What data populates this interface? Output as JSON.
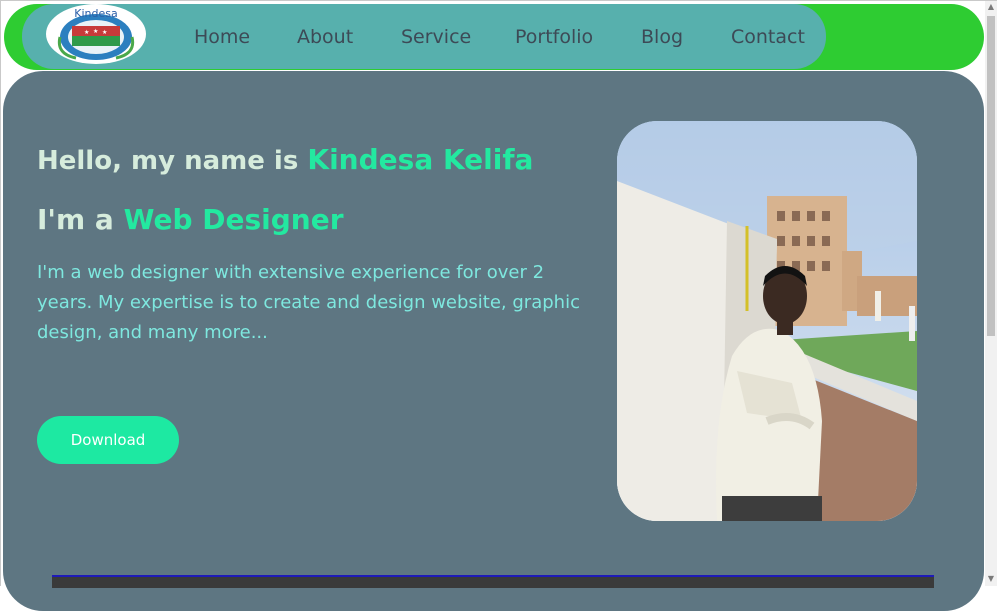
{
  "header": {
    "logo_text": "Kindesa",
    "nav": [
      "Home",
      "About",
      "Service",
      "Portfolio",
      "Blog",
      "Contact"
    ]
  },
  "hero": {
    "greeting": "Hello, my name is",
    "name": "Kindesa Kelifa",
    "role_prefix": "I'm a",
    "role": "Web Designer",
    "bio": "I'm a web designer with extensive experience for over 2 years. My expertise is to create and design website, graphic design, and many more...",
    "download_label": "Download"
  },
  "colors": {
    "header_green": "#2ecc32",
    "nav_bg": "#57b0ad",
    "hero_bg": "#5e7682",
    "accent": "#23e9a0",
    "bio_text": "#7ee8df"
  }
}
